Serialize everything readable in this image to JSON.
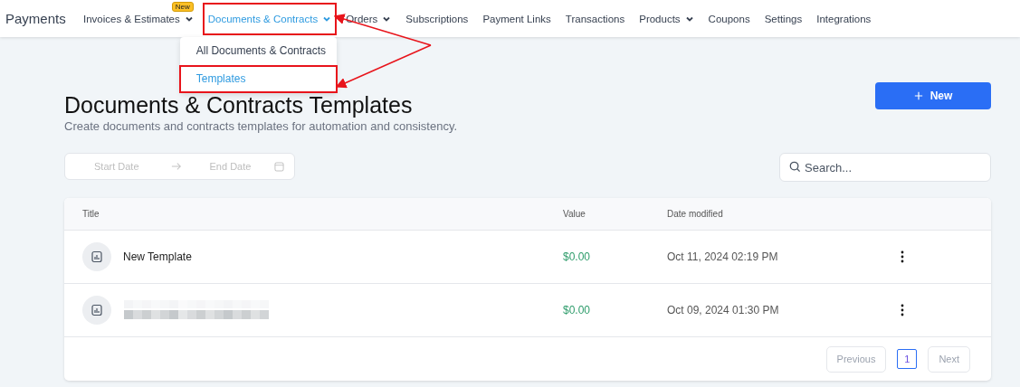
{
  "app_title": "Payments",
  "nav": [
    {
      "label": "Invoices & Estimates",
      "has_menu": true,
      "badge": "New",
      "selected": false,
      "highlighted": false
    },
    {
      "label": "Documents & Contracts",
      "has_menu": true,
      "selected": true,
      "highlighted": true,
      "menu": [
        {
          "label": "All Documents & Contracts",
          "selected": false,
          "highlighted": false
        },
        {
          "label": "Templates",
          "selected": true,
          "highlighted": true
        }
      ]
    },
    {
      "label": "Orders",
      "has_menu": true,
      "selected": false,
      "highlighted": false
    },
    {
      "label": "Subscriptions",
      "has_menu": false,
      "selected": false,
      "highlighted": false
    },
    {
      "label": "Payment Links",
      "has_menu": false,
      "selected": false,
      "highlighted": false
    },
    {
      "label": "Transactions",
      "has_menu": false,
      "selected": false,
      "highlighted": false
    },
    {
      "label": "Products",
      "has_menu": true,
      "selected": false,
      "highlighted": false
    },
    {
      "label": "Coupons",
      "has_menu": false,
      "selected": false,
      "highlighted": false
    },
    {
      "label": "Settings",
      "has_menu": false,
      "selected": false,
      "highlighted": false
    },
    {
      "label": "Integrations",
      "has_menu": false,
      "selected": false,
      "highlighted": false
    }
  ],
  "page": {
    "title": "Documents & Contracts Templates",
    "subtitle": "Create documents and contracts templates for automation and consistency.",
    "new_button": "New"
  },
  "date_range": {
    "start_placeholder": "Start Date",
    "end_placeholder": "End Date"
  },
  "search": {
    "placeholder": "Search..."
  },
  "table": {
    "columns": [
      "Title",
      "Value",
      "Date modified"
    ],
    "rows": [
      {
        "title": "New Template",
        "redacted": false,
        "value": "$0.00",
        "date": "Oct 11, 2024 02:19 PM"
      },
      {
        "redacted": true,
        "value": "$0.00",
        "date": "Oct 09, 2024 01:30 PM"
      }
    ]
  },
  "pagination": {
    "previous": "Previous",
    "next": "Next",
    "pages": [
      {
        "label": "1",
        "selected": true
      }
    ]
  }
}
